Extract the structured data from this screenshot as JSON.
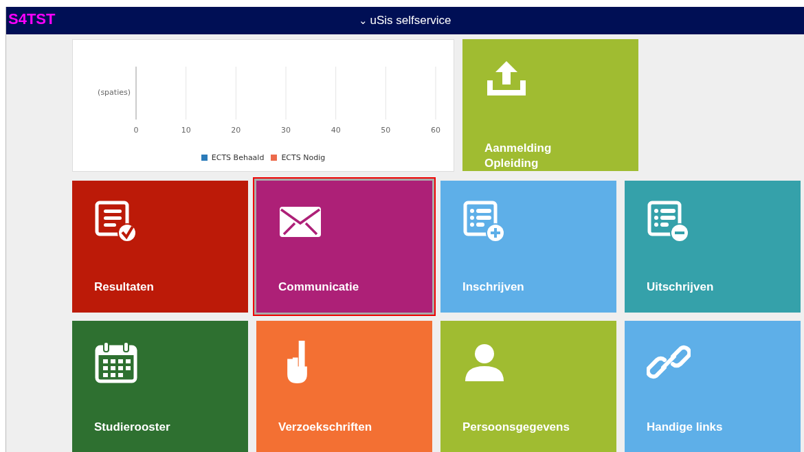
{
  "env_label": "S4TST",
  "header": {
    "caret": "⌄",
    "title": "uSis selfservice"
  },
  "chart_panel": {
    "chart_data": {
      "type": "bar",
      "orientation": "horizontal",
      "categories": [
        "(spaties)"
      ],
      "series": [
        {
          "name": "ECTS Behaald",
          "color": "#2b7bb9",
          "values": [
            null
          ]
        },
        {
          "name": "ECTS Nodig",
          "color": "#ec6a4c",
          "values": [
            null
          ]
        }
      ],
      "xlim": [
        0,
        60
      ],
      "xticks": [
        0,
        10,
        20,
        30,
        40,
        50,
        60
      ],
      "grid": true
    }
  },
  "top_tile": {
    "label": "Aanmelding Opleiding",
    "kind": "upload",
    "color": "#a0bc31",
    "selected": false
  },
  "tiles": [
    {
      "label": "Resultaten",
      "kind": "results",
      "color": "#bc1a08",
      "selected": false
    },
    {
      "label": "Communicatie",
      "kind": "mail",
      "color": "#ad2077",
      "selected": true
    },
    {
      "label": "Inschrijven",
      "kind": "list-add",
      "color": "#5eafe8",
      "selected": false
    },
    {
      "label": "Uitschrijven",
      "kind": "list-remove",
      "color": "#35a1aa",
      "selected": false
    },
    {
      "label": "Studierooster",
      "kind": "calendar",
      "color": "#2e7030",
      "selected": false
    },
    {
      "label": "Verzoekschriften",
      "kind": "hand",
      "color": "#f37033",
      "selected": false
    },
    {
      "label": "Persoonsgegevens",
      "kind": "person",
      "color": "#a0bc31",
      "selected": false
    },
    {
      "label": "Handige links",
      "kind": "link",
      "color": "#5eafe8",
      "selected": false
    }
  ]
}
